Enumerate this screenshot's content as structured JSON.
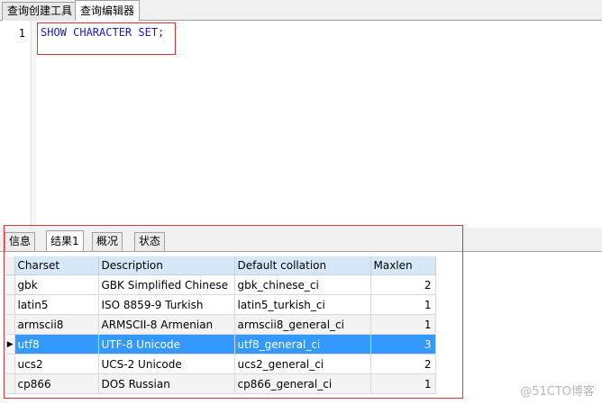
{
  "top_tabs": [
    "查询创建工具",
    "查询编辑器"
  ],
  "editor": {
    "line_number": "1",
    "code": "SHOW CHARACTER SET;"
  },
  "result_tabs": [
    "信息",
    "结果1",
    "概况",
    "状态"
  ],
  "grid": {
    "columns": [
      "Charset",
      "Description",
      "Default collation",
      "Maxlen"
    ],
    "rows": [
      [
        "gbk",
        "GBK Simplified Chinese",
        "gbk_chinese_ci",
        "2"
      ],
      [
        "latin5",
        "ISO 8859-9 Turkish",
        "latin5_turkish_ci",
        "1"
      ],
      [
        "armscii8",
        "ARMSCII-8 Armenian",
        "armscii8_general_ci",
        "1"
      ],
      [
        "utf8",
        "UTF-8 Unicode",
        "utf8_general_ci",
        "3"
      ],
      [
        "ucs2",
        "UCS-2 Unicode",
        "ucs2_general_ci",
        "2"
      ],
      [
        "cp866",
        "DOS Russian",
        "cp866_general_ci",
        "1"
      ]
    ],
    "selected_row": 3
  },
  "watermark": "@51CTO博客",
  "colors": {
    "selection": "#3399ff",
    "header": "#d6e8f7",
    "code": "#1a1acc",
    "highlight_box": "#e03030"
  }
}
